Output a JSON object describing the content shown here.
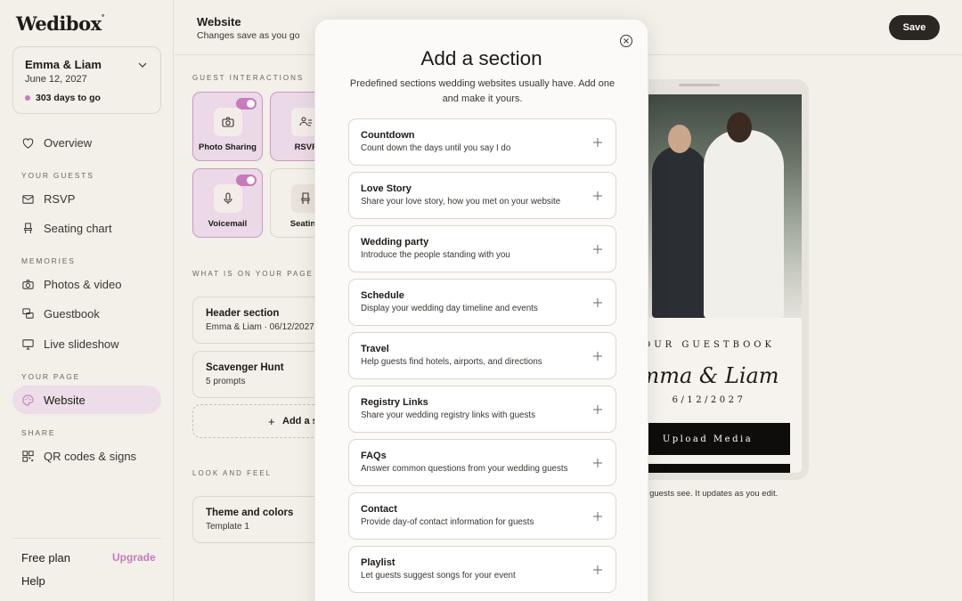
{
  "sidebar": {
    "logo": "Wedibox",
    "couple": {
      "names": "Emma & Liam",
      "date": "June 12, 2027",
      "countdown": "303 days to go"
    },
    "overview": "Overview",
    "sections": {
      "guests": "Your guests",
      "memories": "Memories",
      "page": "Your page",
      "share": "Share"
    },
    "items": {
      "rsvp": "RSVP",
      "seating": "Seating chart",
      "photos": "Photos & video",
      "guestbook": "Guestbook",
      "slideshow": "Live slideshow",
      "website": "Website",
      "qr": "QR codes & signs"
    },
    "free_plan": "Free plan",
    "upgrade": "Upgrade",
    "help": "Help"
  },
  "header": {
    "title": "Website",
    "subtitle": "Changes save as you go",
    "save": "Save"
  },
  "guest_interactions": {
    "label": "Guest interactions",
    "tiles": {
      "photo_sharing": "Photo Sharing",
      "rsvp": "RSVP",
      "voicemail": "Voicemail",
      "seating": "Seatin"
    }
  },
  "on_page": {
    "label": "What is on your page",
    "cards": [
      {
        "title": "Header section",
        "sub": "Emma & Liam · 06/12/2027"
      },
      {
        "title": "Scavenger Hunt",
        "sub": "5 prompts"
      }
    ],
    "add": "Add a s"
  },
  "look": {
    "label": "Look and feel",
    "card": {
      "title": "Theme and colors",
      "sub": "Template 1"
    }
  },
  "preview": {
    "guestbook_label": "OUR GUESTBOOK",
    "names": "mma & Liam",
    "date": "6/12/2027",
    "upload": "Upload Media",
    "caption": "ur guests see. It updates as you edit."
  },
  "modal": {
    "title": "Add a section",
    "subtitle": "Predefined sections wedding websites usually have. Add one and make it yours.",
    "options": [
      {
        "title": "Countdown",
        "desc": "Count down the days until you say I do"
      },
      {
        "title": "Love Story",
        "desc": "Share your love story, how you met on your website"
      },
      {
        "title": "Wedding party",
        "desc": "Introduce the people standing with you"
      },
      {
        "title": "Schedule",
        "desc": "Display your wedding day timeline and events"
      },
      {
        "title": "Travel",
        "desc": "Help guests find hotels, airports, and directions"
      },
      {
        "title": "Registry Links",
        "desc": "Share your wedding registry links with guests"
      },
      {
        "title": "FAQs",
        "desc": "Answer common questions from your wedding guests"
      },
      {
        "title": "Contact",
        "desc": "Provide day-of contact information for guests"
      },
      {
        "title": "Playlist",
        "desc": "Let guests suggest songs for your event"
      }
    ]
  },
  "colors": {
    "accent": "#c77bbd",
    "dark": "#2a2622",
    "background": "#f3efe9"
  }
}
